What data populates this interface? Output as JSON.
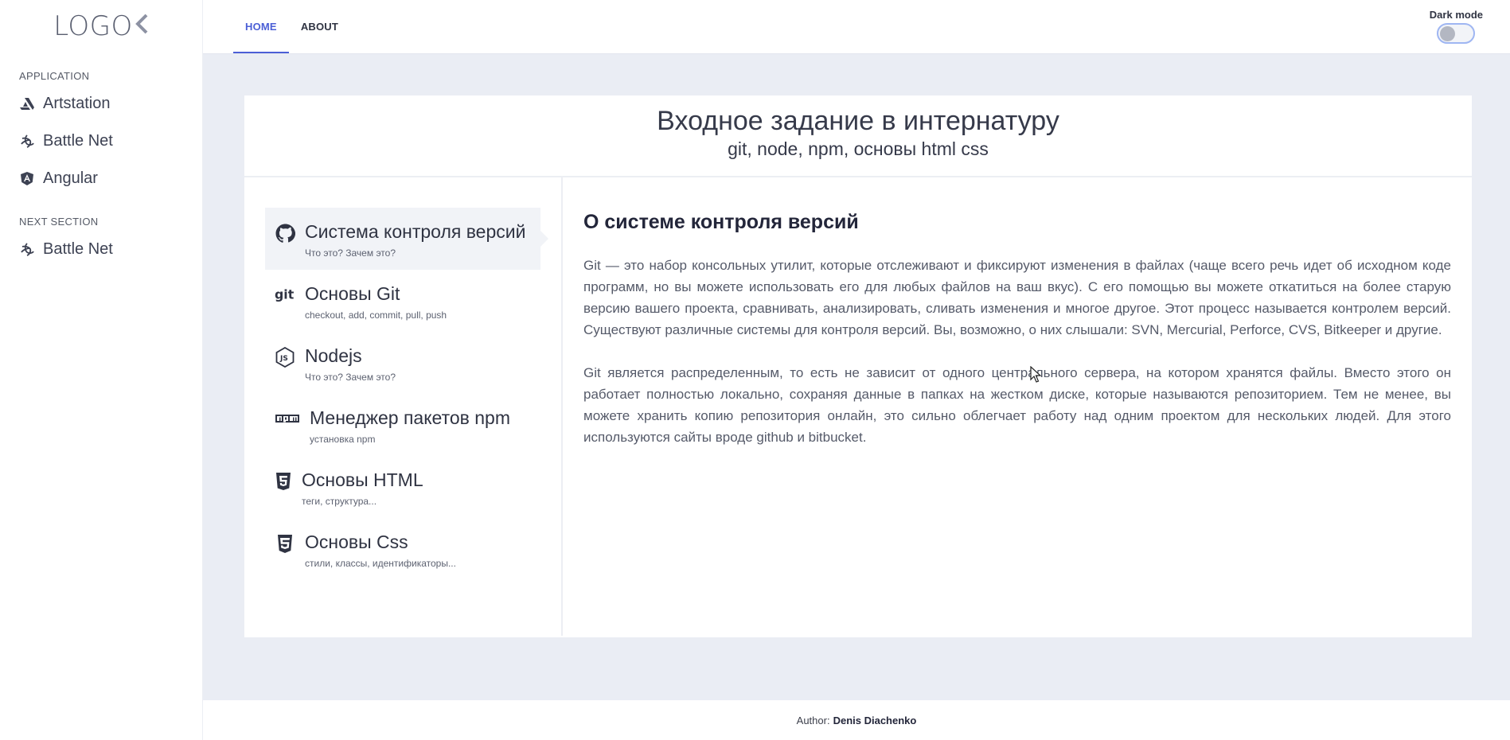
{
  "logo": {
    "text": "LOGO",
    "chevron": "‹"
  },
  "sidebar": {
    "sections": [
      {
        "heading": "APPLICATION",
        "items": [
          {
            "label": "Artstation",
            "icon": "artstation-icon"
          },
          {
            "label": "Battle Net",
            "icon": "battlenet-icon"
          },
          {
            "label": "Angular",
            "icon": "angular-icon"
          }
        ]
      },
      {
        "heading": "NEXT SECTION",
        "items": [
          {
            "label": "Battle Net",
            "icon": "battlenet-icon"
          }
        ]
      }
    ]
  },
  "topbar": {
    "tabs": [
      {
        "label": "HOME",
        "active": true
      },
      {
        "label": "ABOUT",
        "active": false
      }
    ],
    "dark_mode_label": "Dark mode",
    "dark_mode_on": false
  },
  "card": {
    "title": "Входное задание в интернатуру",
    "subtitle": "git, node, npm, основы html css"
  },
  "lessons": [
    {
      "title": "Система контроля версий",
      "sub": "Что это? Зачем это?",
      "icon": "github-icon",
      "active": true
    },
    {
      "title": "Основы Git",
      "sub": "checkout, add, commit, pull, push",
      "icon": "git-icon",
      "active": false
    },
    {
      "title": "Nodejs",
      "sub": "Что это? Зачем это?",
      "icon": "nodejs-icon",
      "active": false
    },
    {
      "title": "Менеджер пакетов npm",
      "sub": "установка npm",
      "icon": "npm-icon",
      "active": false
    },
    {
      "title": "Основы HTML",
      "sub": "теги, структура...",
      "icon": "html5-icon",
      "active": false
    },
    {
      "title": "Основы Css",
      "sub": "стили, классы, идентификаторы...",
      "icon": "css3-icon",
      "active": false
    }
  ],
  "content": {
    "heading": "О системе контроля версий",
    "paragraphs": [
      "Git — это набор консольных утилит, которые отслеживают и фиксируют изменения в файлах (чаще всего речь идет об исходном коде программ, но вы можете использовать его для любых файлов на ваш вкус). С его помощью вы можете откатиться на более старую версию вашего проекта, сравнивать, анализировать, сливать изменения и многое другое. Этот процесс называется контролем версий. Существуют различные системы для контроля версий. Вы, возможно, о них слышали: SVN, Mercurial, Perforce, CVS, Bitkeeper и другие.",
      "Git является распределенным, то есть не зависит от одного центрального сервера, на котором хранятся файлы. Вместо этого он работает полностью локально, сохраняя данные в папках на жестком диске, которые называются репозиторием. Тем не менее, вы можете хранить копию репозитория онлайн, это сильно облегчает работу над одним проектом для нескольких людей. Для этого используются сайты вроде github и bitbucket."
    ]
  },
  "footer": {
    "prefix": "Author:",
    "author": "Denis Diachenko"
  },
  "colors": {
    "accent": "#4b5fd6",
    "background": "#eaedf4"
  }
}
